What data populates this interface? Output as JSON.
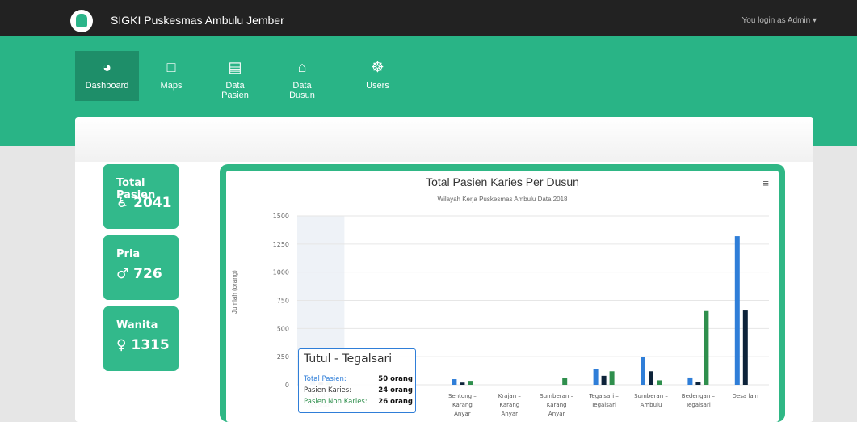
{
  "header": {
    "brand": "SIGKI Puskesmas Ambulu Jember",
    "login": "You login as Admin ▾"
  },
  "nav": [
    {
      "label": "Dashboard",
      "icon": "dashboard-icon",
      "glyph": "◕"
    },
    {
      "label": "Maps",
      "icon": "monitor-icon",
      "glyph": "□"
    },
    {
      "label": "Data Pasien",
      "icon": "briefcase-icon",
      "glyph": "▤"
    },
    {
      "label": "Data Dusun",
      "icon": "home-icon",
      "glyph": "⌂"
    },
    {
      "label": "Users",
      "icon": "users-icon",
      "glyph": "☸"
    }
  ],
  "stats": [
    {
      "title": "Total Pasien",
      "value": "2041",
      "icon": "wheelchair-icon",
      "glyph": "♿"
    },
    {
      "title": "Pria",
      "value": "726",
      "icon": "male-icon",
      "glyph": "♂"
    },
    {
      "title": "Wanita",
      "value": "1315",
      "icon": "female-icon",
      "glyph": "♀"
    }
  ],
  "chart_data": {
    "type": "bar",
    "title": "Total Pasien Karies Per Dusun",
    "subtitle": "Wilayah Kerja Puskesmas Ambulu Data 2018",
    "ylabel": "Jumlah (orang)",
    "ylim": [
      0,
      1500
    ],
    "yticks": [
      "0",
      "250",
      "500",
      "750",
      "1000",
      "1250",
      "1500"
    ],
    "categories": [
      "Tutul - Tegalsari",
      "",
      "",
      "Sentong - Karang Anyar",
      "Krajan - Karang Anyar",
      "Sumberan - Karang Anyar",
      "Tegalsari - Tegalsari",
      "Sumberan - Ambulu",
      "Bedengan - Tegalsari",
      "Desa lain"
    ],
    "series": [
      {
        "name": "Total Pasien",
        "color": "#2f7ed8",
        "values": [
          50,
          0,
          0,
          50,
          0,
          0,
          140,
          245,
          65,
          1320
        ]
      },
      {
        "name": "Pasien Karies",
        "color": "#0d233a",
        "values": [
          24,
          0,
          0,
          20,
          0,
          0,
          80,
          120,
          25,
          660
        ]
      },
      {
        "name": "Pasien Non Karies",
        "color": "#2f8f4d",
        "values": [
          26,
          0,
          0,
          35,
          0,
          60,
          120,
          40,
          655,
          0
        ]
      }
    ],
    "legend": "none",
    "highlighted_category": "Tutul - Tegalsari"
  },
  "tooltip": {
    "title": "Tutul - Tegalsari",
    "rows": [
      {
        "label": "Total Pasien:",
        "value": "50 orang",
        "color": "#2f7ed8"
      },
      {
        "label": "Pasien Karies:",
        "value": "24 orang",
        "color": "#333333"
      },
      {
        "label": "Pasien Non Karies:",
        "value": "26 orang",
        "color": "#2f8f4d"
      }
    ]
  }
}
